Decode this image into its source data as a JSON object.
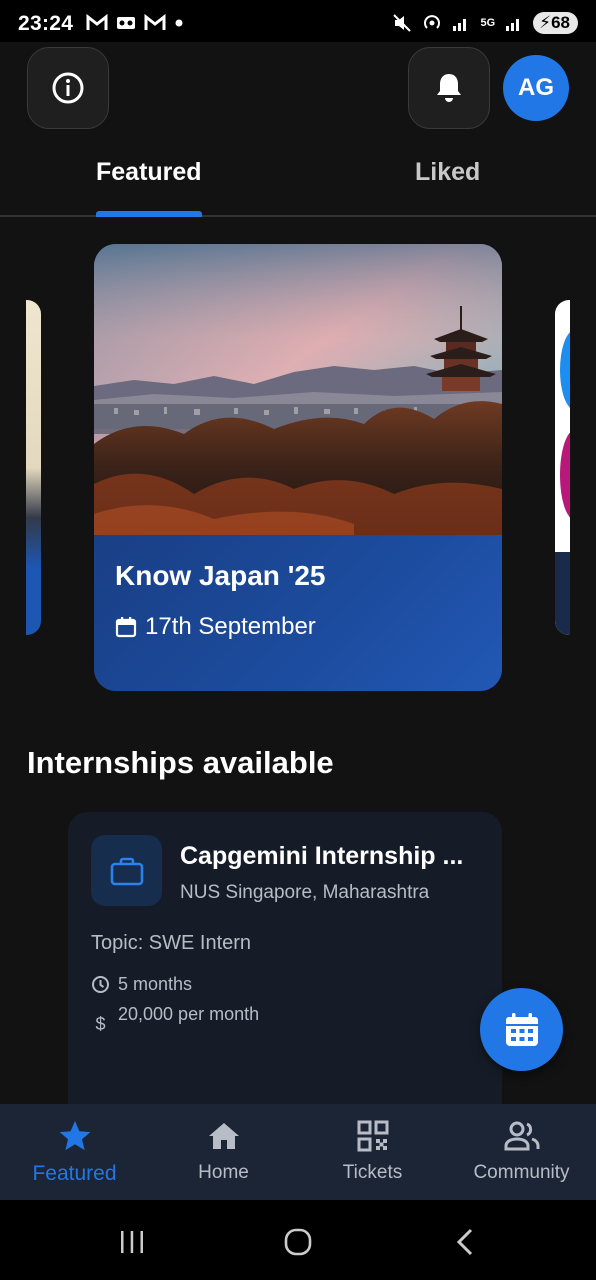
{
  "status_bar": {
    "time": "23:24",
    "left_icons": [
      "gmail-icon",
      "voicemail-icon",
      "gmail-icon",
      "dot-icon"
    ],
    "right_icons": [
      "mute-icon",
      "hotspot-icon",
      "signal-icon",
      "5g-signal-icon",
      "signal-icon"
    ],
    "network_label": "5G",
    "battery": "68"
  },
  "header": {
    "info_icon": "info-icon",
    "bell_icon": "bell-icon",
    "avatar_initials": "AG"
  },
  "tabs": [
    {
      "label": "Featured",
      "active": true
    },
    {
      "label": "Liked",
      "active": false
    }
  ],
  "featured_card": {
    "title": "Know Japan '25",
    "date": "17th September",
    "date_icon": "calendar-icon"
  },
  "internships": {
    "section_title": "Internships available",
    "items": [
      {
        "title": "Capgemini Internship ...",
        "location": "NUS Singapore, Maharashtra",
        "topic": "Topic: SWE Intern",
        "duration": "5 months",
        "stipend": "20,000 per month"
      }
    ]
  },
  "fab": {
    "icon": "calendar-icon"
  },
  "bottom_nav": [
    {
      "label": "Featured",
      "icon": "star-icon",
      "active": true
    },
    {
      "label": "Home",
      "icon": "home-icon",
      "active": false
    },
    {
      "label": "Tickets",
      "icon": "qr-code-icon",
      "active": false
    },
    {
      "label": "Community",
      "icon": "people-icon",
      "active": false
    }
  ],
  "colors": {
    "accent": "#2277e6",
    "background": "#121212",
    "card_blue": "#1c4c9f",
    "nav_bg": "#1c2535"
  }
}
